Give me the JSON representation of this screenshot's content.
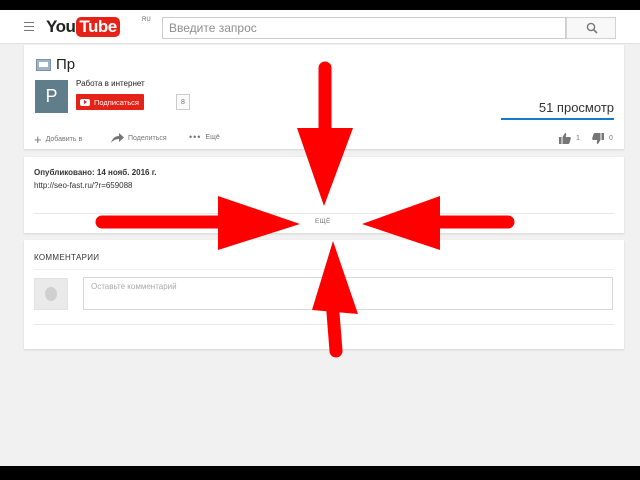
{
  "masthead": {
    "logo_you": "You",
    "logo_tube": "Tube",
    "logo_region": "RU",
    "search_placeholder": "Введите запрос"
  },
  "video": {
    "title": "Пр",
    "channel_avatar_letter": "P",
    "channel_name": "Работа в интернет",
    "subscribe_label": "Подписаться",
    "subscriber_count": "8",
    "view_count": "51 просмотр",
    "actions": {
      "add_to": "Добавить в",
      "share": "Поделиться",
      "more": "Ещё"
    },
    "likes": "1",
    "dislikes": "0"
  },
  "description": {
    "published": "Опубликовано: 14 нояб. 2016 г.",
    "link": "http://seo-fast.ru/?r=659088",
    "show_more": "ЕЩЁ"
  },
  "comments": {
    "header": "КОММЕНТАРИИ",
    "input_placeholder": "Оставьте комментарий"
  },
  "colors": {
    "brand_red": "#e62117",
    "link_blue": "#167ac6",
    "annotation_arrow_red": "#ff0000"
  },
  "icons": [
    "menu-icon",
    "search-icon",
    "plus-icon",
    "share-arrow-icon",
    "more-dots-icon",
    "thumbs-up-icon",
    "thumbs-down-icon",
    "youtube-play-icon"
  ]
}
